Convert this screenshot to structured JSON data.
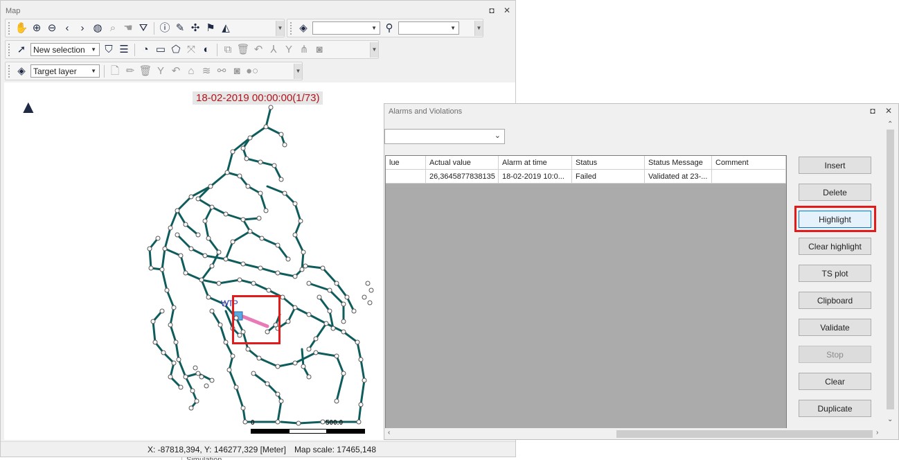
{
  "map_window": {
    "title": "Map",
    "selection_combo": "New selection",
    "target_layer_combo": "Target layer",
    "layer_combo": "",
    "search_combo": "",
    "time_label": "18-02-2019 00:00:00(1/73)",
    "map_labels": {
      "north": "▲",
      "wtp": "WTP"
    },
    "scale_bar": {
      "start": "0",
      "end": "500.0"
    },
    "status": {
      "coordinates": "X: -87818,394, Y: 146277,329 [Meter]",
      "scale": "Map scale: 17465,148"
    }
  },
  "alarms_window": {
    "title": "Alarms and Violations",
    "filter_combo": "",
    "columns": [
      "lue",
      "Actual value",
      "Alarm at time",
      "Status",
      "Status Message",
      "Comment"
    ],
    "rows": [
      [
        "",
        "26,3645877838135",
        "18-02-2019 10:0...",
        "Failed",
        "Validated at 23-...",
        ""
      ]
    ],
    "buttons": [
      "Insert",
      "Delete",
      "Highlight",
      "Clear highlight",
      "TS plot",
      "Clipboard",
      "Validate",
      "Stop",
      "Clear",
      "Duplicate"
    ]
  },
  "background": {
    "simulation_label": "Simulation"
  },
  "colors": {
    "pipe": "#0f5c5c",
    "highlight_pipe": "#e87ab8",
    "alert": "#e21a1a",
    "time_text": "#b0141a"
  },
  "window_controls": {
    "restore": "◘",
    "close": "✕"
  }
}
